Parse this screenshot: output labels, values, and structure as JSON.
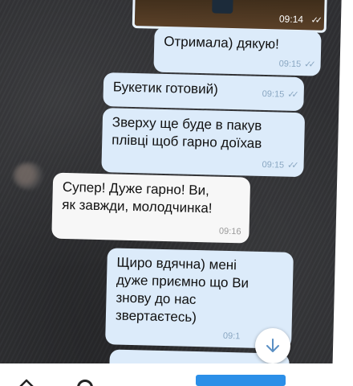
{
  "top_photo": {
    "time": "09:14"
  },
  "messages": [
    {
      "direction": "out",
      "text": "Отримала) дякую!",
      "time": "09:15"
    },
    {
      "direction": "out",
      "text": "Букетик готовий)",
      "time": "09:15"
    },
    {
      "direction": "out",
      "text": "Зверху ще буде в пакув\nплівці щоб гарно доїхав",
      "time": "09:15"
    },
    {
      "direction": "in",
      "text": "Супер! Дуже гарно! Ви,\nяк завжди, молодчинка!",
      "time": "09:16"
    },
    {
      "direction": "out",
      "text": "Щиро вдячна)  мені\nдуже приємно що Ви\nзнову до нас\nзвертаєтесь)",
      "time": "09:1"
    }
  ],
  "colors": {
    "outgoing_bubble": "#dcebfa",
    "incoming_bubble": "#f7f7f7",
    "accent": "#2b8fe8"
  },
  "icons": {
    "read_ticks": "double-check-icon",
    "scroll_down": "arrow-down-icon",
    "nav_up": "chevron-up-icon",
    "nav_circle": "circle-icon"
  }
}
